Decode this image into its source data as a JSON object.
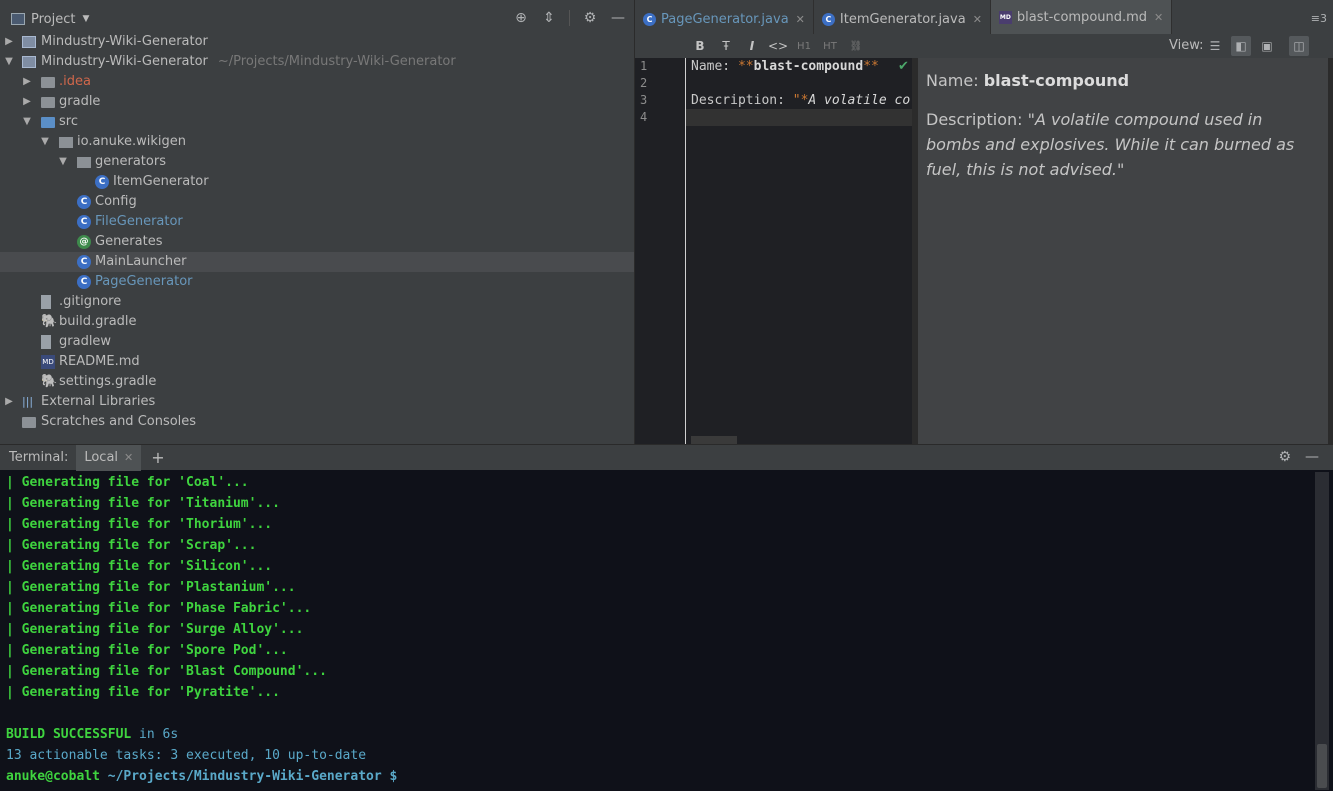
{
  "project_panel": {
    "title": "Project",
    "tree": [
      {
        "label": "Mindustry-Wiki-Generator",
        "hint": "",
        "icon": "module",
        "arrow": "▶",
        "depth": 0
      },
      {
        "label": "Mindustry-Wiki-Generator",
        "hint": "~/Projects/Mindustry-Wiki-Generator",
        "icon": "module",
        "arrow": "▼",
        "depth": 0
      },
      {
        "label": ".idea",
        "hint": "",
        "icon": "folder",
        "arrow": "▶",
        "depth": 1
      },
      {
        "label": "gradle",
        "hint": "",
        "icon": "folder",
        "arrow": "▶",
        "depth": 1
      },
      {
        "label": "src",
        "hint": "",
        "icon": "folder-blue",
        "arrow": "▼",
        "depth": 1
      },
      {
        "label": "io.anuke.wikigen",
        "hint": "",
        "icon": "package",
        "arrow": "▼",
        "depth": 2
      },
      {
        "label": "generators",
        "hint": "",
        "icon": "package",
        "arrow": "▼",
        "depth": 3
      },
      {
        "label": "ItemGenerator",
        "hint": "",
        "icon": "class",
        "arrow": "",
        "depth": 4
      },
      {
        "label": "Config",
        "hint": "",
        "icon": "class",
        "arrow": "",
        "depth": 3
      },
      {
        "label": "FileGenerator",
        "hint": "",
        "icon": "class",
        "arrow": "",
        "depth": 3
      },
      {
        "label": "Generates",
        "hint": "",
        "icon": "annotation",
        "arrow": "",
        "depth": 3
      },
      {
        "label": "MainLauncher",
        "hint": "",
        "icon": "class",
        "arrow": "",
        "depth": 3
      },
      {
        "label": "PageGenerator",
        "hint": "",
        "icon": "class",
        "arrow": "",
        "depth": 3
      },
      {
        "label": ".gitignore",
        "hint": "",
        "icon": "file",
        "arrow": "",
        "depth": 1
      },
      {
        "label": "build.gradle",
        "hint": "",
        "icon": "gradle",
        "arrow": "",
        "depth": 1
      },
      {
        "label": "gradlew",
        "hint": "",
        "icon": "file",
        "arrow": "",
        "depth": 1
      },
      {
        "label": "README.md",
        "hint": "",
        "icon": "md",
        "arrow": "",
        "depth": 1
      },
      {
        "label": "settings.gradle",
        "hint": "",
        "icon": "gradle",
        "arrow": "",
        "depth": 1
      },
      {
        "label": "External Libraries",
        "hint": "",
        "icon": "libs",
        "arrow": "▶",
        "depth": 0
      },
      {
        "label": "Scratches and Consoles",
        "hint": "",
        "icon": "scratch",
        "arrow": "",
        "depth": 0
      }
    ]
  },
  "editor": {
    "tabs": [
      {
        "label": "PageGenerator.java",
        "icon": "C"
      },
      {
        "label": "ItemGenerator.java",
        "icon": "C"
      },
      {
        "label": "blast-compound.md",
        "icon": "MD"
      }
    ],
    "toolbar": {
      "bold": "B",
      "strike": "Ŧ",
      "italic": "I",
      "code": "<>",
      "h1": "H1",
      "ht": "HT",
      "link": "⛓",
      "view_label": "View:"
    },
    "line_numbers": [
      "1",
      "2",
      "3",
      "4"
    ],
    "code": {
      "l1_key": "Name: ",
      "l1_mark_open": "**",
      "l1_value": "blast-compound",
      "l1_mark_close": "**",
      "l3_key": "Description: ",
      "l3_quote": "\"",
      "l3_mark": "*",
      "l3_value": "A volatile co"
    },
    "preview": {
      "name_key": "Name: ",
      "name_value": "blast-compound",
      "desc_key": "Description: ",
      "desc_value": "\"A volatile compound used in bombs and explosives. While it can burned as fuel, this is not advised.\""
    }
  },
  "terminal": {
    "title": "Terminal:",
    "tab": "Local",
    "lines": [
      "| Generating file for 'Coal'...",
      "| Generating file for 'Titanium'...",
      "| Generating file for 'Thorium'...",
      "| Generating file for 'Scrap'...",
      "| Generating file for 'Silicon'...",
      "| Generating file for 'Plastanium'...",
      "| Generating file for 'Phase Fabric'...",
      "| Generating file for 'Surge Alloy'...",
      "| Generating file for 'Spore Pod'...",
      "| Generating file for 'Blast Compound'...",
      "| Generating file for 'Pyratite'..."
    ],
    "build_status": "BUILD SUCCESSFUL",
    "build_time": " in 6s",
    "tasks": "13 actionable tasks: 3 executed, 10 up-to-date",
    "prompt_user": "anuke@cobalt",
    "prompt_path": " ~/Projects/Mindustry-Wiki-Generator",
    "prompt_dollar": " $"
  },
  "colors": {
    "accent": "#9a5aa8",
    "terminal_green": "#3fd43f",
    "terminal_cyan": "#5aa9c9"
  }
}
